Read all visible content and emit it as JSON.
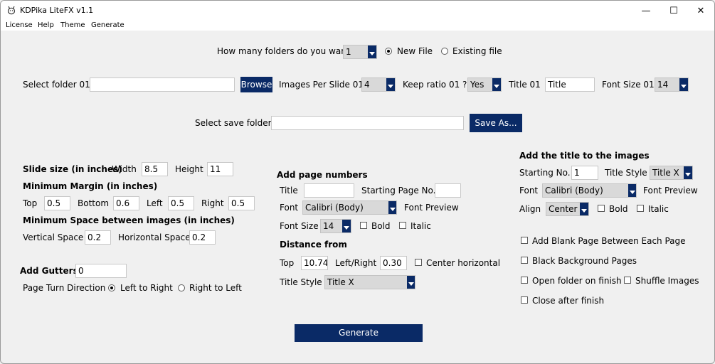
{
  "window": {
    "title": "KDPika LiteFX v1.1",
    "min": "—",
    "max": "☐",
    "close": "✕"
  },
  "menu": [
    "License",
    "Help",
    "Theme",
    "Generate"
  ],
  "folders": {
    "label": "How many folders do you want",
    "count": "1",
    "new_file": "New File",
    "existing_file": "Existing file"
  },
  "folder01": {
    "label": "Select folder 01",
    "path": "",
    "browse": "Browse",
    "ips_label": "Images Per Slide 01",
    "ips_value": "4",
    "keep_label": "Keep ratio 01 ?",
    "keep_value": "Yes",
    "title_label": "Title 01",
    "title_value": "Title",
    "font_size_label": "Font Size 01",
    "font_size_value": "14"
  },
  "save": {
    "label": "Select save folder",
    "path": "",
    "button": "Save As..."
  },
  "slide": {
    "heading": "Slide size (in inches)",
    "width_label": "Width",
    "width": "8.5",
    "height_label": "Height",
    "height": "11",
    "margin_heading": "Minimum Margin (in inches)",
    "top_label": "Top",
    "top": "0.5",
    "bottom_label": "Bottom",
    "bottom": "0.6",
    "left_label": "Left",
    "left": "0.5",
    "right_label": "Right",
    "right": "0.5",
    "space_heading": "Minimum Space between images (in inches)",
    "vspace_label": "Vertical Space",
    "vspace": "0.2",
    "hspace_label": "Horizontal Space",
    "hspace": "0.2",
    "gutters_label": "Add Gutters",
    "gutters": "0",
    "direction_label": "Page Turn Direction",
    "ltr": "Left to Right",
    "rtl": "Right to Left"
  },
  "pagenum": {
    "heading": "Add page numbers",
    "title_label": "Title",
    "title": "",
    "start_label": "Starting Page No.",
    "start": "",
    "font_label": "Font",
    "font": "Calibri (Body)",
    "preview": "Font Preview",
    "size_label": "Font Size",
    "size": "14",
    "bold": "Bold",
    "italic": "Italic",
    "distance_heading": "Distance from",
    "top_label": "Top",
    "top": "10.74",
    "lr_label": "Left/Right",
    "lr": "0.30",
    "center": "Center horizontal",
    "style_label": "Title Style",
    "style": "Title X"
  },
  "titleimg": {
    "heading": "Add the title to the images",
    "start_label": "Starting No.",
    "start": "1",
    "style_label": "Title Style",
    "style": "Title X",
    "font_label": "Font",
    "font": "Calibri (Body)",
    "preview": "Font Preview",
    "align_label": "Align",
    "align": "Center",
    "bold": "Bold",
    "italic": "Italic"
  },
  "options": {
    "blank_page": "Add Blank Page Between Each Page",
    "black_bg": "Black Background Pages",
    "open_folder": "Open folder on finish",
    "shuffle": "Shuffle Images",
    "close_after": "Close after finish"
  },
  "generate_button": "Generate"
}
